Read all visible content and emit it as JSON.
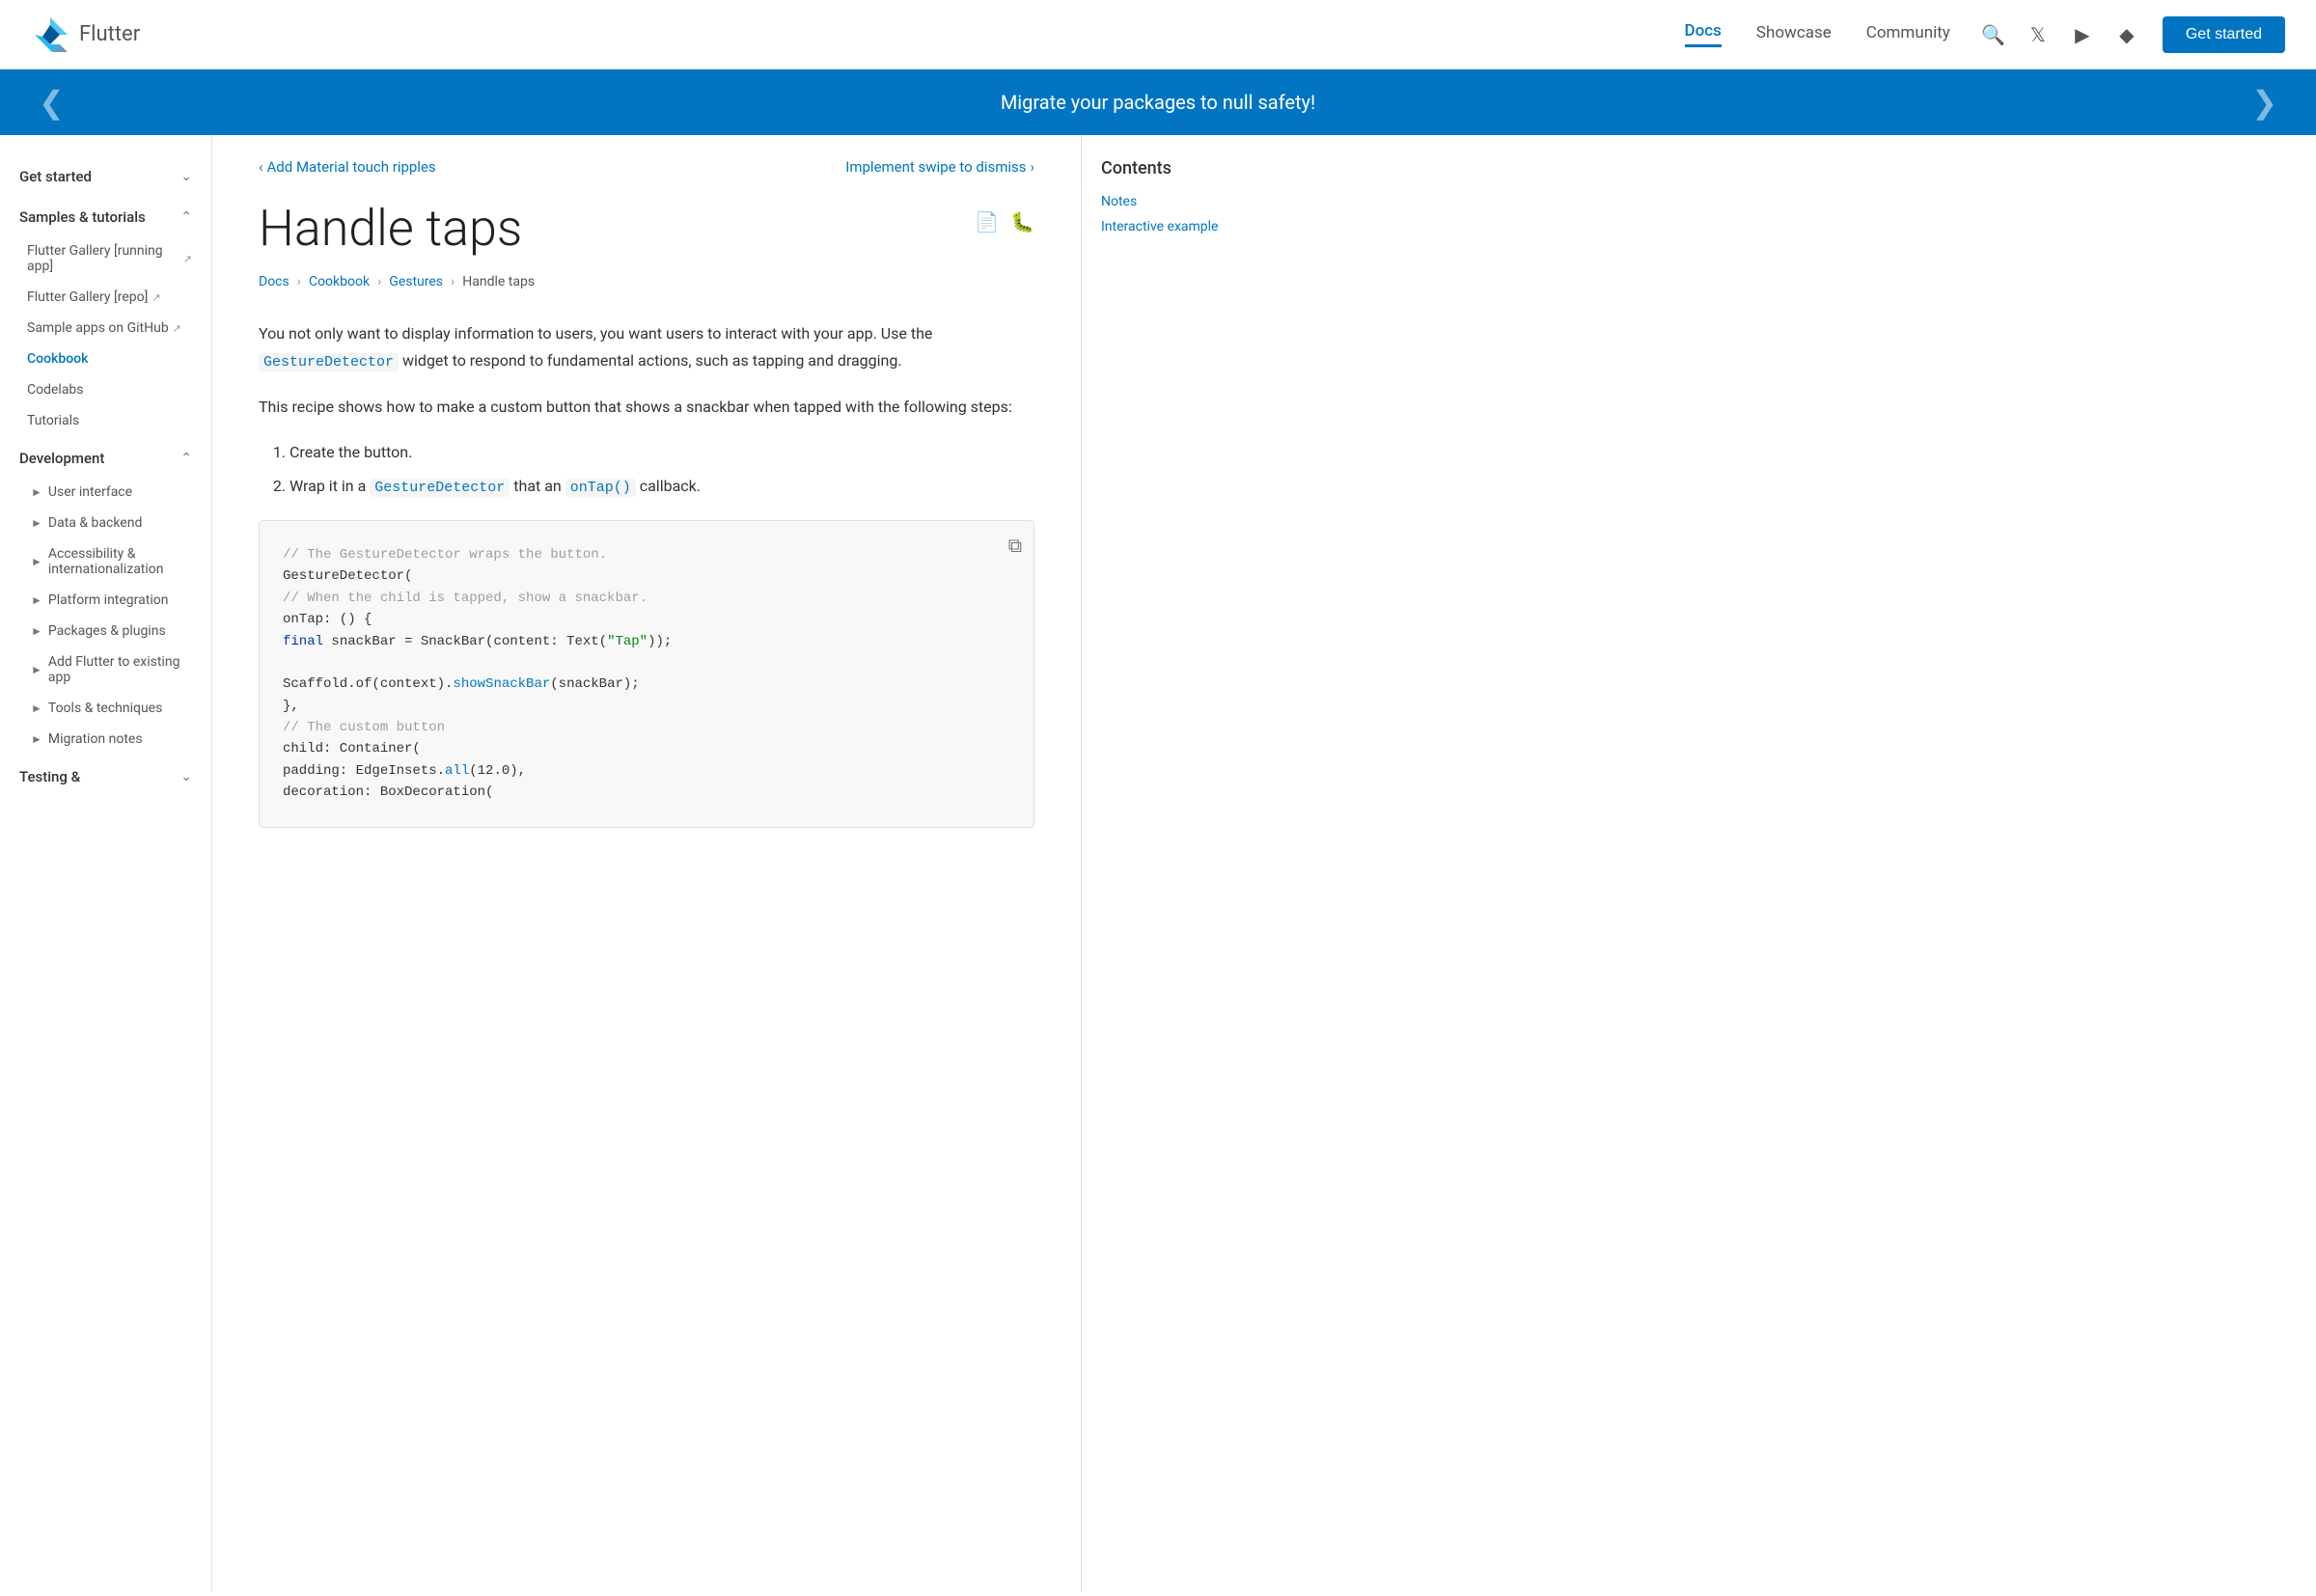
{
  "header": {
    "logo_text": "Flutter",
    "nav": [
      {
        "label": "Docs",
        "active": true
      },
      {
        "label": "Showcase",
        "active": false
      },
      {
        "label": "Community",
        "active": false
      }
    ],
    "get_started_label": "Get started"
  },
  "banner": {
    "text": "Migrate your packages to null safety!"
  },
  "sidebar": {
    "sections": [
      {
        "label": "Get started",
        "expanded": false,
        "chevron": "expand_more"
      },
      {
        "label": "Samples & tutorials",
        "expanded": true,
        "items": [
          {
            "label": "Flutter Gallery [running app]",
            "external": true,
            "active": false
          },
          {
            "label": "Flutter Gallery [repo]",
            "external": true,
            "active": false
          },
          {
            "label": "Sample apps on GitHub",
            "external": true,
            "active": false
          },
          {
            "label": "Cookbook",
            "active": true
          },
          {
            "label": "Codelabs",
            "active": false
          },
          {
            "label": "Tutorials",
            "active": false
          }
        ]
      },
      {
        "label": "Development",
        "expanded": true,
        "sub_items": [
          {
            "label": "User interface"
          },
          {
            "label": "Data & backend"
          },
          {
            "label": "Accessibility & internationalization"
          },
          {
            "label": "Platform integration"
          },
          {
            "label": "Packages & plugins"
          },
          {
            "label": "Add Flutter to existing app"
          },
          {
            "label": "Tools & techniques"
          },
          {
            "label": "Migration notes"
          }
        ]
      },
      {
        "label": "Testing &",
        "expanded": false
      }
    ]
  },
  "page": {
    "prev_link": "Add Material touch ripples",
    "next_link": "Implement swipe to dismiss",
    "title": "Handle taps",
    "breadcrumb": [
      "Docs",
      "Cookbook",
      "Gestures",
      "Handle taps"
    ],
    "intro_p1": "You not only want to display information to users, you want users to interact with your app. Use the GestureDetector widget to respond to fundamental actions, such as tapping and dragging.",
    "intro_gesture_link": "GestureDetector",
    "intro_p2": "This recipe shows how to make a custom button that shows a snackbar when tapped with the following steps:",
    "steps": [
      "Create the button.",
      "Wrap it in a GestureDetector that an onTap() callback."
    ],
    "step2_gesture_link": "GestureDetector",
    "step2_ontap_link": "onTap()"
  },
  "code": {
    "lines": [
      {
        "type": "comment",
        "text": "// The GestureDetector wraps the button."
      },
      {
        "type": "class",
        "text": "GestureDetector("
      },
      {
        "type": "comment",
        "text": "  // When the child is tapped, show a snackbar."
      },
      {
        "type": "normal",
        "text": "  onTap: () {"
      },
      {
        "type": "mixed",
        "parts": [
          {
            "t": "keyword",
            "v": "    final"
          },
          {
            "t": "normal",
            "v": " snackBar = SnackBar(content: Text("
          },
          {
            "t": "string",
            "v": "\"Tap\""
          },
          {
            "t": "normal",
            "v": "));"
          }
        ]
      },
      {
        "type": "blank"
      },
      {
        "type": "mixed",
        "parts": [
          {
            "t": "normal",
            "v": "    Scaffold.of(context)."
          },
          {
            "t": "method",
            "v": "showSnackBar"
          },
          {
            "t": "normal",
            "v": "(snackBar);"
          }
        ]
      },
      {
        "type": "normal",
        "text": "  },"
      },
      {
        "type": "comment",
        "text": "  // The custom button"
      },
      {
        "type": "normal",
        "text": "  child: Container("
      },
      {
        "type": "mixed",
        "parts": [
          {
            "t": "normal",
            "v": "    padding: EdgeInsets."
          },
          {
            "t": "method",
            "v": "all"
          },
          {
            "t": "normal",
            "v": "(12.0),"
          }
        ]
      },
      {
        "type": "normal",
        "text": "    decoration: BoxDecoration("
      }
    ]
  },
  "contents": {
    "title": "Contents",
    "links": [
      {
        "label": "Notes"
      },
      {
        "label": "Interactive example"
      }
    ]
  }
}
